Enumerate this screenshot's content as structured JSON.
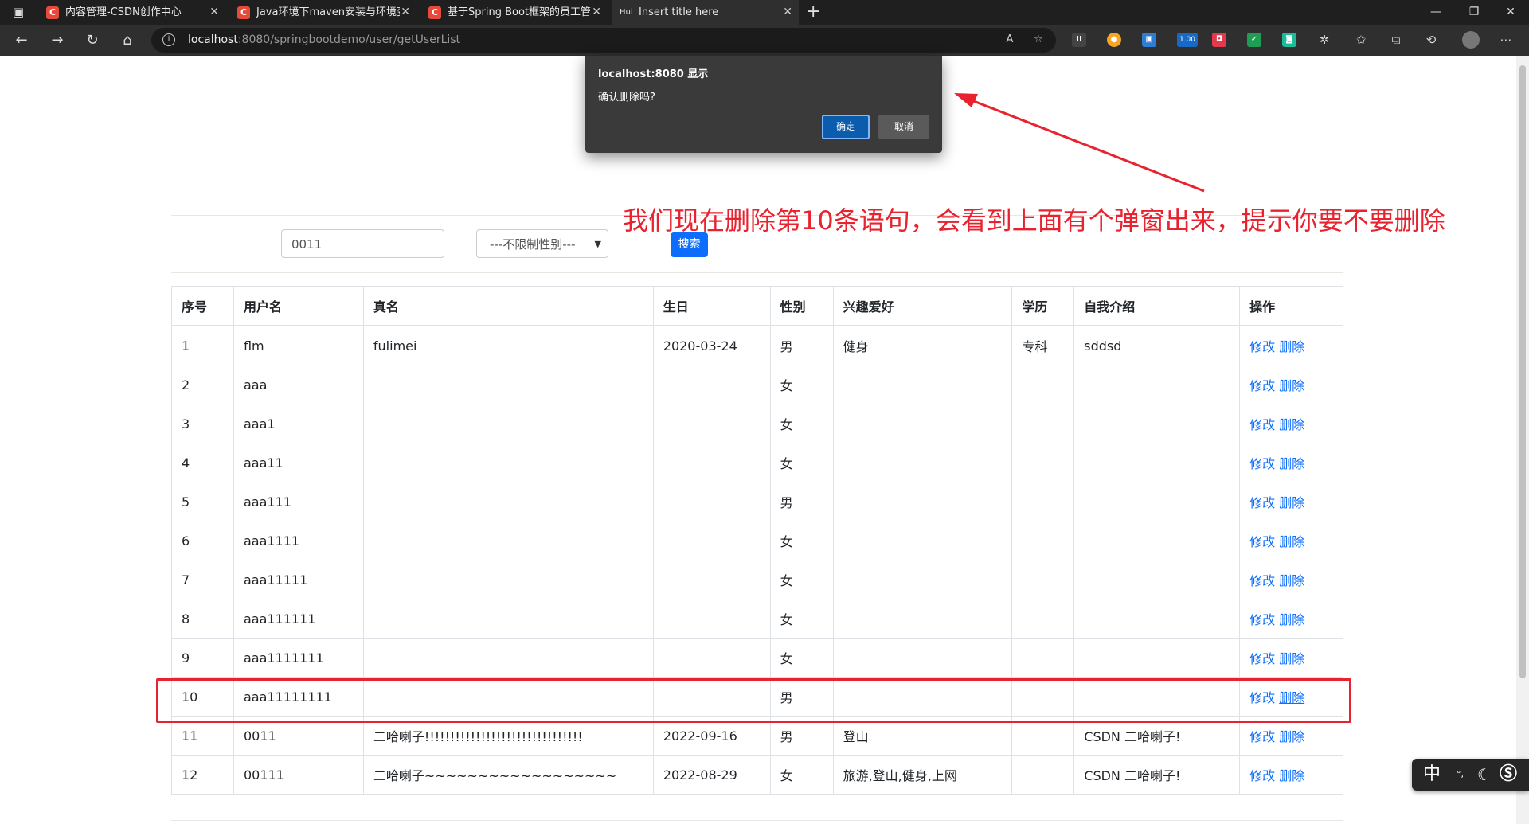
{
  "browser": {
    "tabs": [
      {
        "title": "内容管理-CSDN创作中心",
        "favicon": "C",
        "active": false
      },
      {
        "title": "Java环境下maven安装与环境变量",
        "favicon": "C",
        "active": false
      },
      {
        "title": "基于Spring Boot框架的员工管理",
        "favicon": "C",
        "active": false
      },
      {
        "title": "Insert title here",
        "favicon": "Hui",
        "active": true
      }
    ],
    "new_tab": "+",
    "url_host": "localhost",
    "url_rest": ":8080/springbootdemo/user/getUserList",
    "ext_badge": "1.00"
  },
  "search": {
    "keyword_value": "0011",
    "gender_selected": "---不限制性别---",
    "search_label": "搜索"
  },
  "table": {
    "headers": [
      "序号",
      "用户名",
      "真名",
      "生日",
      "性别",
      "兴趣爱好",
      "学历",
      "自我介绍",
      "操作"
    ],
    "rows": [
      [
        "1",
        "flm",
        "fulimei",
        "2020-03-24",
        "男",
        "健身",
        "专科",
        "sddsd"
      ],
      [
        "2",
        "aaa",
        "",
        "",
        "女",
        "",
        "",
        ""
      ],
      [
        "3",
        "aaa1",
        "",
        "",
        "女",
        "",
        "",
        ""
      ],
      [
        "4",
        "aaa11",
        "",
        "",
        "女",
        "",
        "",
        ""
      ],
      [
        "5",
        "aaa111",
        "",
        "",
        "男",
        "",
        "",
        ""
      ],
      [
        "6",
        "aaa1111",
        "",
        "",
        "女",
        "",
        "",
        ""
      ],
      [
        "7",
        "aaa11111",
        "",
        "",
        "女",
        "",
        "",
        ""
      ],
      [
        "8",
        "aaa111111",
        "",
        "",
        "女",
        "",
        "",
        ""
      ],
      [
        "9",
        "aaa1111111",
        "",
        "",
        "女",
        "",
        "",
        ""
      ],
      [
        "10",
        "aaa11111111",
        "",
        "",
        "男",
        "",
        "",
        ""
      ],
      [
        "11",
        "0011",
        "二哈喇子!!!!!!!!!!!!!!!!!!!!!!!!!!!!!!!",
        "2022-09-16",
        "男",
        "登山",
        "",
        "CSDN 二哈喇子!"
      ],
      [
        "12",
        "00111",
        "二哈喇子~~~~~~~~~~~~~~~~~~",
        "2022-08-29",
        "女",
        "旅游,登山,健身,上网",
        "",
        "CSDN 二哈喇子!"
      ]
    ],
    "edit_label": "修改",
    "delete_label": "删除"
  },
  "dialog": {
    "title": "localhost:8080 显示",
    "message": "确认删除吗?",
    "ok_label": "确定",
    "cancel_label": "取消"
  },
  "annotation": {
    "text": "我们现在删除第10条语句，会看到上面有个弹窗出来，提示你要不要删除",
    "color": "#e8222e"
  },
  "ime": {
    "mode": "中",
    "punct": "°,"
  },
  "colors": {
    "accent": "#0d6efd",
    "dialog_bg": "#3a3a3a",
    "chrome_bg": "#1f1f1f"
  }
}
